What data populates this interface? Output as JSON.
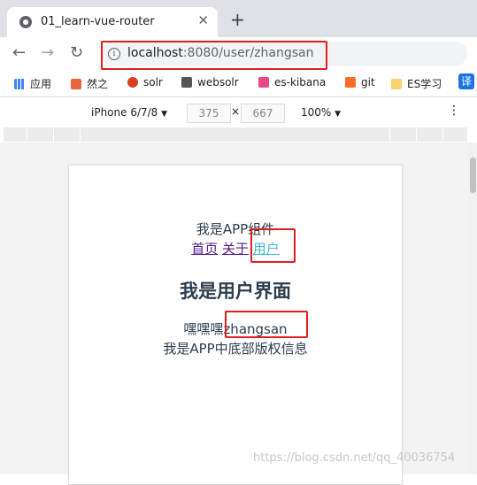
{
  "tab": {
    "title": "01_learn-vue-router",
    "close": "✕",
    "new_tab": "+"
  },
  "toolbar": {
    "back": "←",
    "forward": "→",
    "reload": "↻",
    "info": "i",
    "url_host": "localhost",
    "url_rest": ":8080/user/zhangsan"
  },
  "bookmarks": [
    {
      "label": "应用",
      "color": "#4285f4"
    },
    {
      "label": "然之",
      "color": "#e8643c"
    },
    {
      "label": "solr",
      "color": "#d9411e"
    },
    {
      "label": "websolr",
      "color": "#555555"
    },
    {
      "label": "es-kibana",
      "color": "#e8478b"
    },
    {
      "label": "git",
      "color": "#fc6d26"
    },
    {
      "label": "ES学习",
      "color": "#f6d36b"
    },
    {
      "label": "译",
      "color": "#1a73e8"
    }
  ],
  "devtools": {
    "device": "iPhone 6/7/8",
    "device_caret": "▼",
    "width": "375",
    "x": "×",
    "height": "667",
    "zoom": "100%",
    "zoom_caret": "▼",
    "more": "⋮"
  },
  "app": {
    "component_text": "我是APP组件",
    "nav": {
      "home": "首页",
      "about": "关于",
      "user": "用户"
    },
    "heading": "我是用户界面",
    "user_prefix": "嘿嘿嘿",
    "user_id": "zhangsan",
    "footer": "我是APP中底部版权信息"
  },
  "watermark": "https://blog.csdn.net/qq_40036754"
}
